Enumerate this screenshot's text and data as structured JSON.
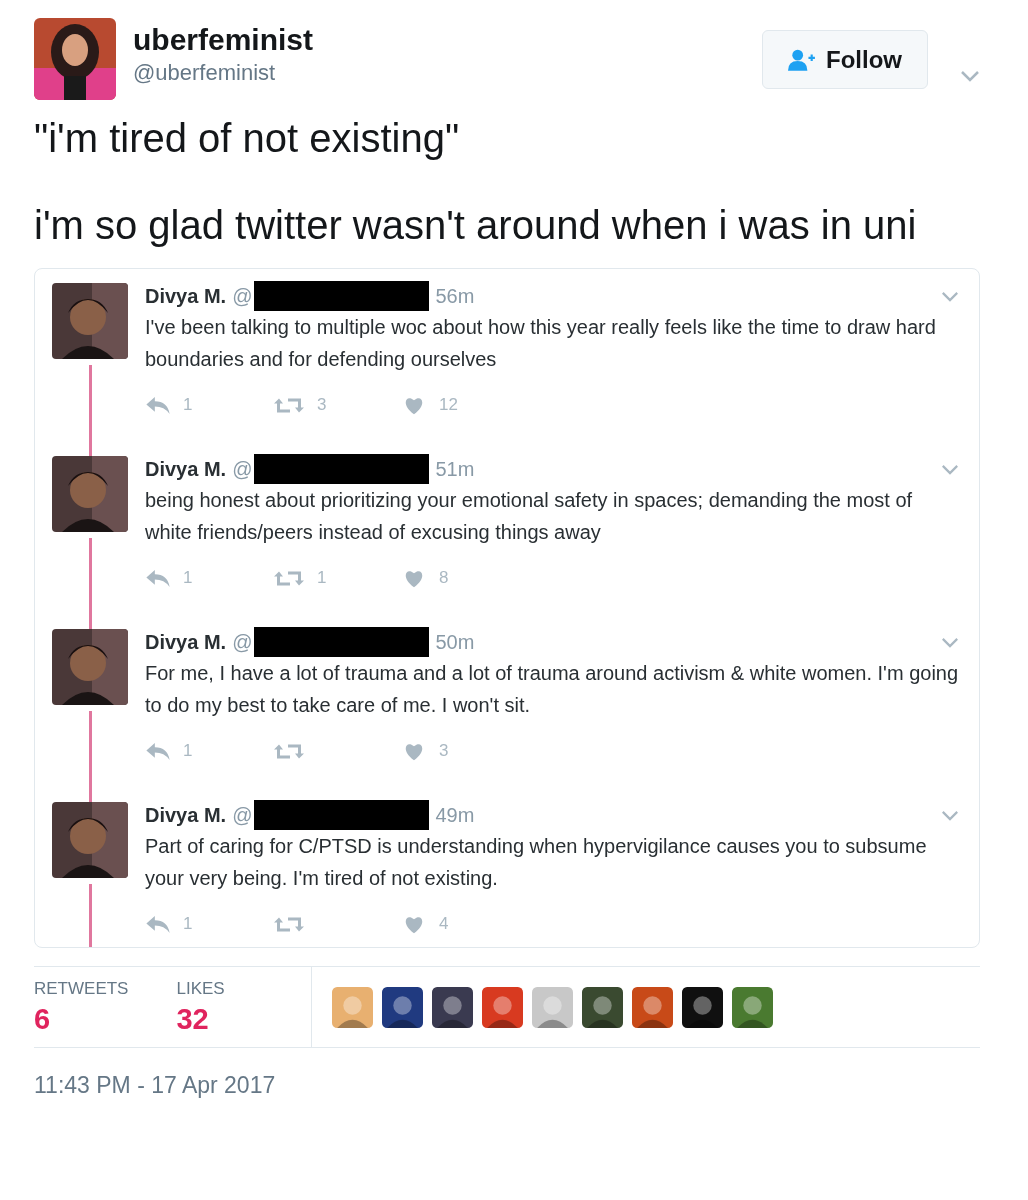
{
  "author": {
    "name": "uberfeminist",
    "handle": "@uberfeminist"
  },
  "follow_button": {
    "label": "Follow"
  },
  "tweet_text": [
    "\"i'm tired of not existing\"",
    "i'm so glad twitter wasn't around when i was in uni"
  ],
  "quoted_thread": [
    {
      "name": "Divya M.",
      "handle": "@",
      "time": "56m",
      "text": "I've been talking to multiple woc about how this year really feels like the time to draw hard boundaries and for defending ourselves",
      "replies": "1",
      "retweets": "3",
      "likes": "12"
    },
    {
      "name": "Divya M.",
      "handle": "@",
      "time": "51m",
      "text": "being honest about prioritizing your emotional safety in spaces; demanding the most of white friends/peers instead of excusing things away",
      "replies": "1",
      "retweets": "1",
      "likes": "8"
    },
    {
      "name": "Divya M.",
      "handle": "@",
      "time": "50m",
      "text": "For me, I have a lot of trauma and a lot of trauma around activism & white women. I'm going to do my best to take care of me. I won't sit.",
      "replies": "1",
      "likes": "3"
    },
    {
      "name": "Divya M.",
      "handle": "@",
      "time": "49m",
      "text": "Part of caring for C/PTSD is understanding when hypervigilance causes you to subsume your very being. I'm tired of not existing.",
      "replies": "1",
      "likes": "4"
    }
  ],
  "stats": [
    {
      "label": "RETWEETS",
      "value": "6"
    },
    {
      "label": "LIKES",
      "value": "32"
    }
  ],
  "timestamp": "11:43 PM - 17 Apr 2017"
}
